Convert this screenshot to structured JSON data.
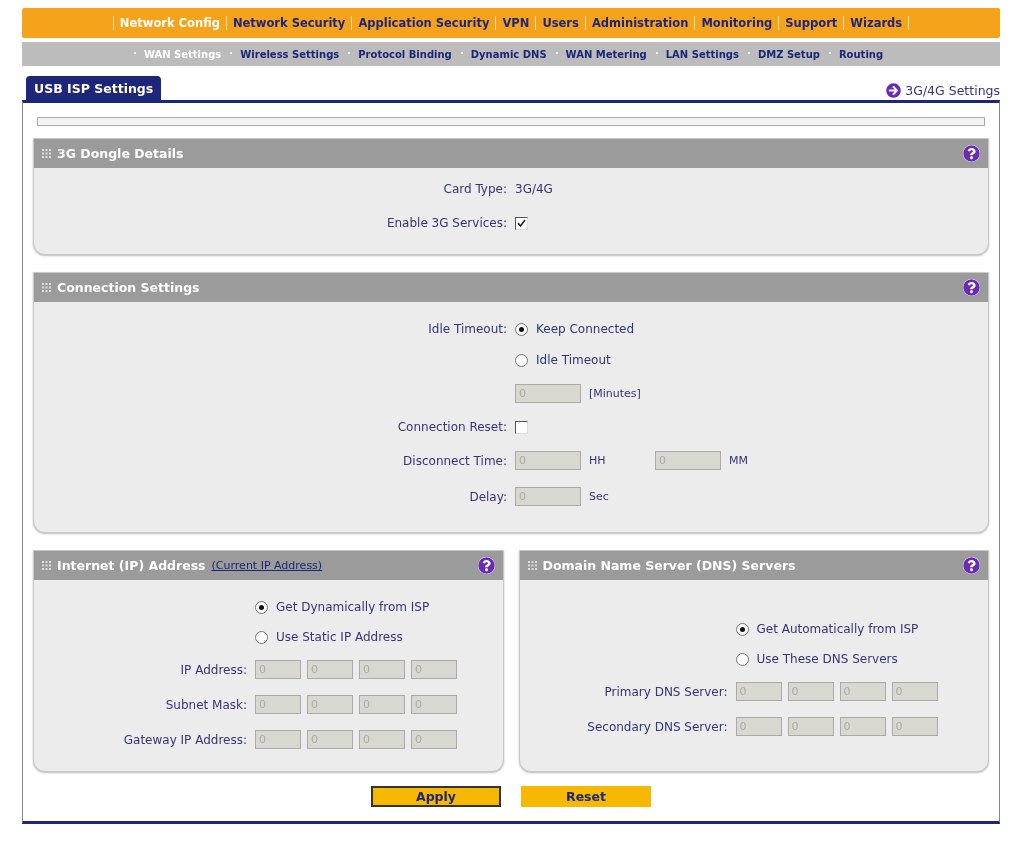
{
  "top_nav": [
    {
      "label": "Network Config",
      "selected": true
    },
    {
      "label": "Network Security",
      "selected": false
    },
    {
      "label": "Application Security",
      "selected": false
    },
    {
      "label": "VPN",
      "selected": false
    },
    {
      "label": "Users",
      "selected": false
    },
    {
      "label": "Administration",
      "selected": false
    },
    {
      "label": "Monitoring",
      "selected": false
    },
    {
      "label": "Support",
      "selected": false
    },
    {
      "label": "Wizards",
      "selected": false
    }
  ],
  "sub_nav": [
    {
      "label": "WAN Settings",
      "selected": true
    },
    {
      "label": "Wireless Settings",
      "selected": false
    },
    {
      "label": "Protocol Binding",
      "selected": false
    },
    {
      "label": "Dynamic DNS",
      "selected": false
    },
    {
      "label": "WAN Metering",
      "selected": false
    },
    {
      "label": "LAN Settings",
      "selected": false
    },
    {
      "label": "DMZ Setup",
      "selected": false
    },
    {
      "label": "Routing",
      "selected": false
    }
  ],
  "tab": {
    "label": "USB ISP Settings",
    "selected": true
  },
  "side_link": "3G/4G Settings",
  "sections": [
    {
      "title": "3G Dongle Details",
      "rows": [
        {
          "kind": "text",
          "label": "Card Type:",
          "value": "3G/4G"
        },
        {
          "kind": "checkbox",
          "label": "Enable 3G Services:",
          "checked": true
        }
      ]
    },
    {
      "title": "Connection Settings",
      "rows": [
        {
          "kind": "radio",
          "label": "Idle Timeout:",
          "option": "Keep Connected",
          "selected": true
        },
        {
          "kind": "radio",
          "option": "Idle Timeout",
          "selected": false
        },
        {
          "kind": "fields",
          "fields": [
            {
              "value": "0",
              "unit": "[Minutes]",
              "disabled": true
            }
          ]
        },
        {
          "kind": "checkbox",
          "label": "Connection Reset:",
          "checked": false
        },
        {
          "kind": "fields",
          "label": "Disconnect Time:",
          "fields": [
            {
              "value": "0",
              "unit": "HH",
              "disabled": true
            },
            {
              "value": "0",
              "unit": "MM",
              "disabled": true
            }
          ]
        },
        {
          "kind": "fields",
          "label": "Delay:",
          "fields": [
            {
              "value": "0",
              "unit": "Sec",
              "disabled": true
            }
          ]
        }
      ]
    }
  ],
  "half_sections": [
    {
      "title": "Internet (IP) Address",
      "link": "(Current IP Address)",
      "rows": [
        {
          "kind": "radio",
          "option": "Get Dynamically from ISP",
          "selected": true
        },
        {
          "kind": "radio",
          "option": "Use Static IP Address",
          "selected": false
        },
        {
          "kind": "ip",
          "label": "IP Address:",
          "octets": [
            "0",
            "0",
            "0",
            "0"
          ],
          "disabled": true
        },
        {
          "kind": "ip",
          "label": "Subnet Mask:",
          "octets": [
            "0",
            "0",
            "0",
            "0"
          ],
          "disabled": true
        },
        {
          "kind": "ip",
          "label": "Gateway IP Address:",
          "octets": [
            "0",
            "0",
            "0",
            "0"
          ],
          "disabled": true
        }
      ]
    },
    {
      "title": "Domain Name Server (DNS) Servers",
      "rows": [
        {
          "kind": "radio",
          "option": "Get Automatically from ISP",
          "selected": true
        },
        {
          "kind": "radio",
          "option": "Use These DNS Servers",
          "selected": false
        },
        {
          "kind": "ip",
          "label": "Primary DNS Server:",
          "octets": [
            "0",
            "0",
            "0",
            "0"
          ],
          "disabled": true
        },
        {
          "kind": "ip",
          "label": "Secondary DNS Server:",
          "octets": [
            "0",
            "0",
            "0",
            "0"
          ],
          "disabled": true
        }
      ]
    }
  ],
  "buttons": [
    {
      "label": "Apply",
      "kind": "primary"
    },
    {
      "label": "Reset",
      "kind": "secondary"
    }
  ]
}
